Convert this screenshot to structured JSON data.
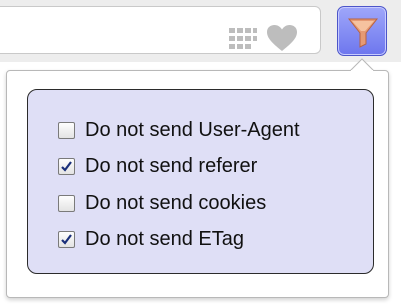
{
  "toolbar": {
    "icons": [
      "grid-icon",
      "heart-icon"
    ],
    "extension_button_icon": "funnel-icon",
    "colors": {
      "button_fill": "#8f97f6",
      "funnel": "#e69a74"
    }
  },
  "popup": {
    "panel_color": "#dfdff6",
    "options": [
      {
        "label": "Do not send User-Agent",
        "checked": false
      },
      {
        "label": "Do not send referer",
        "checked": true
      },
      {
        "label": "Do not send cookies",
        "checked": false
      },
      {
        "label": "Do not send ETag",
        "checked": true
      }
    ]
  }
}
